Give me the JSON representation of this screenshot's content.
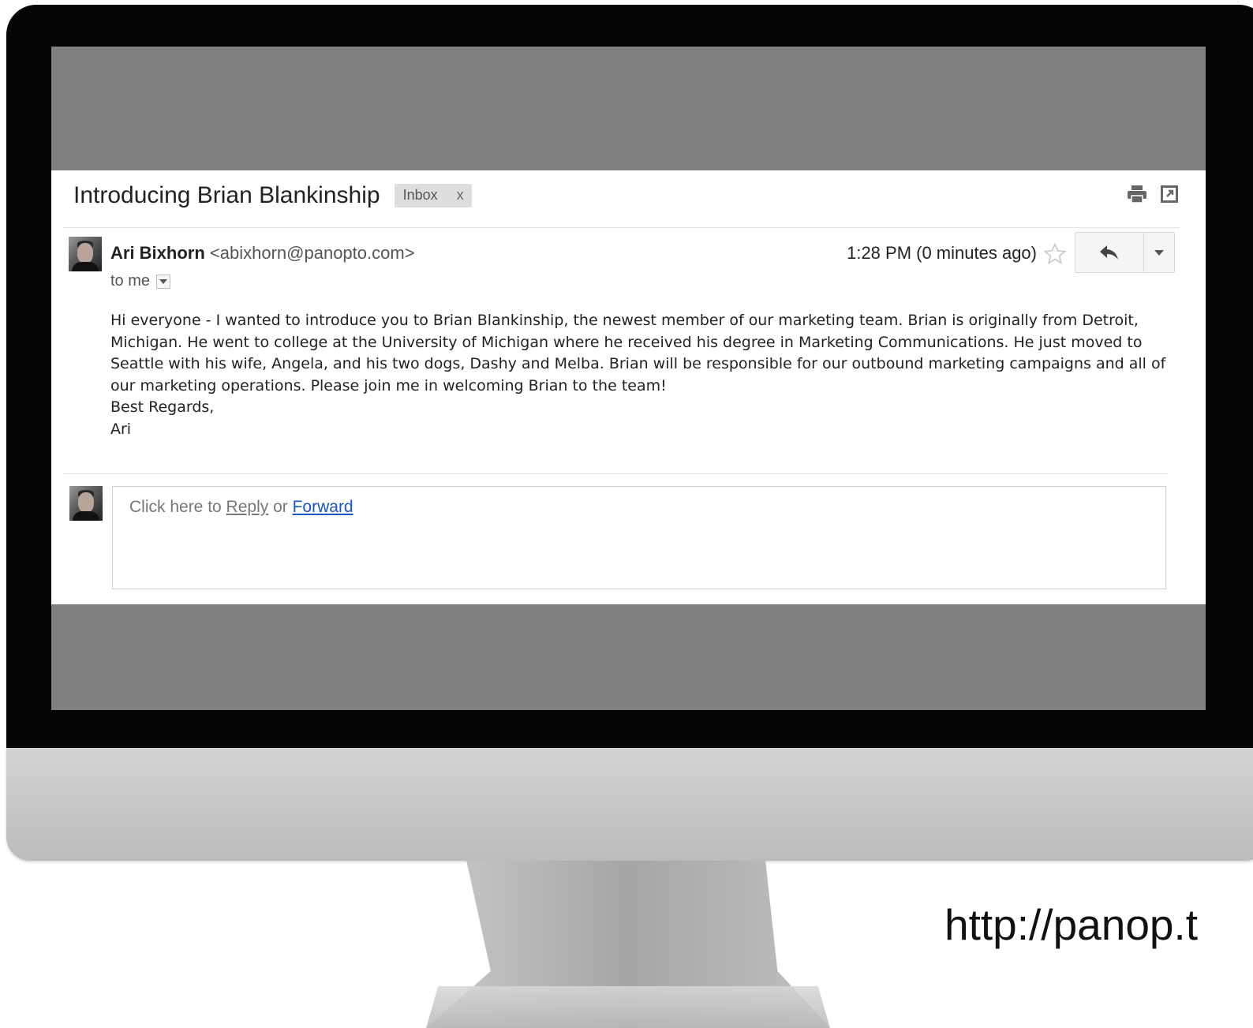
{
  "email": {
    "subject": "Introducing Brian Blankinship",
    "label": "Inbox",
    "label_remove": "x",
    "icons": {
      "print": "print-icon",
      "new_window": "open-in-new-window-icon",
      "star": "star-icon",
      "reply": "reply-arrow-icon",
      "more": "dropdown-triangle-icon"
    },
    "sender": {
      "name": "Ari Bixhorn",
      "address": "<abixhorn@panopto.com>",
      "to": "to me"
    },
    "time": "1:28 PM (0 minutes ago)",
    "body": [
      "Hi everyone - I wanted to introduce you to Brian Blankinship, the newest member of our marketing team. Brian is originally from Detroit, Michigan. He went to college at the University of Michigan where he received his degree in Marketing Communications. He just moved to Seattle with his wife, Angela, and his two dogs, Dashy and Melba. Brian will be responsible for our outbound marketing campaigns and all of our marketing operations. Please join me in welcoming Brian to the team!",
      "Best Regards,",
      "Ari"
    ],
    "reply_box": {
      "prefix": "Click here to ",
      "reply": "Reply",
      "middle": " or ",
      "forward": "Forward"
    }
  },
  "caption": {
    "url": "http://panop.t"
  },
  "colors": {
    "screen_gray": "#808080",
    "forward_link": "#1a55c5",
    "bezel": "#050505"
  }
}
